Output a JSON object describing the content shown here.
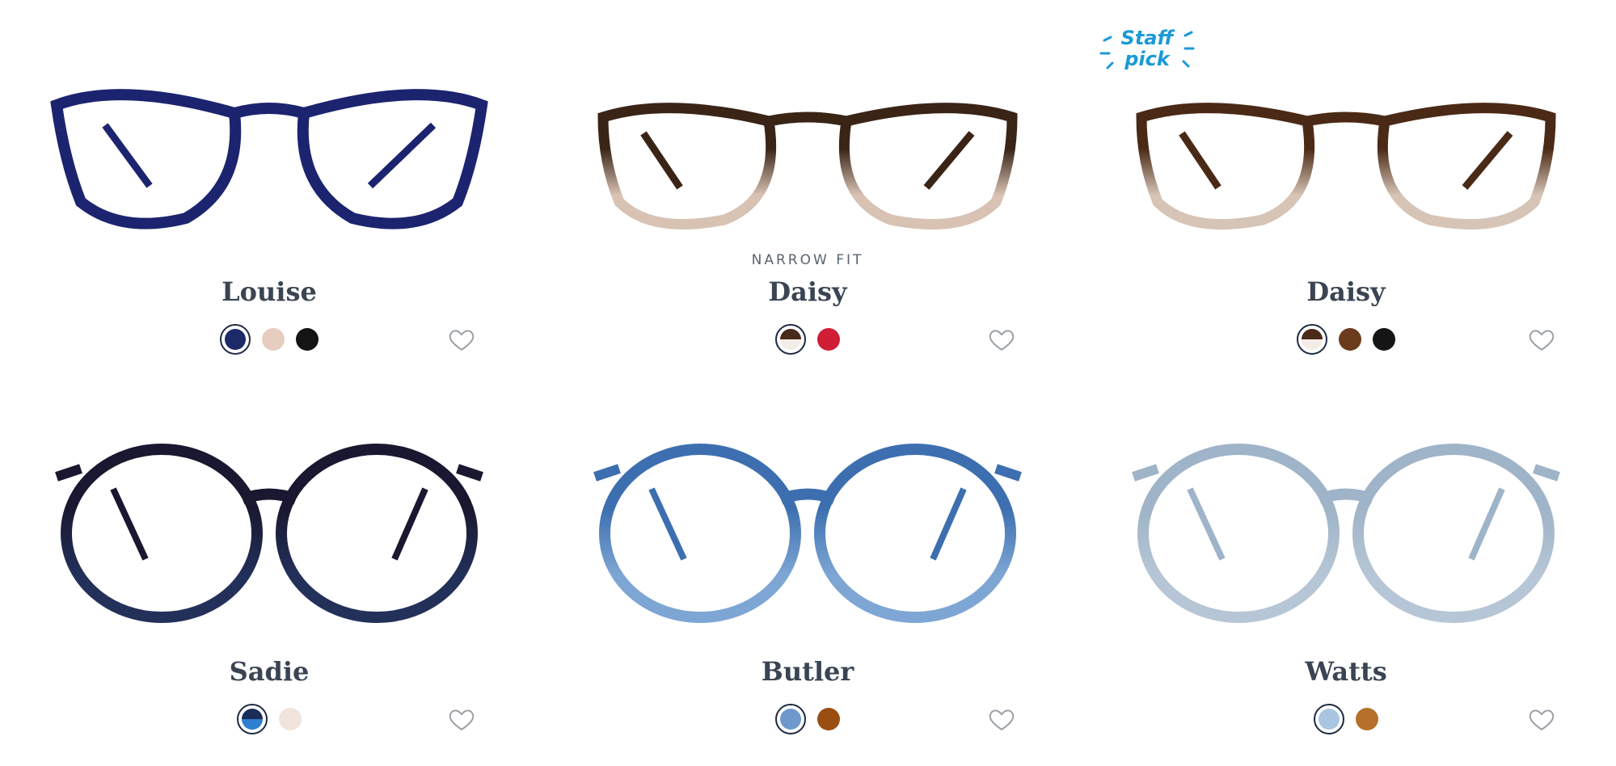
{
  "staff_pick_label": [
    "Staff",
    "pick"
  ],
  "products": [
    {
      "name": "Louise",
      "fit_label": "",
      "frame_style": "cat",
      "frame_color": "#1c2470",
      "frame_color_bottom": "#1c2470",
      "swatches": [
        {
          "color": "#1c2a6a",
          "selected": true
        },
        {
          "color": "#e7cdc0",
          "selected": false
        },
        {
          "color": "#141414",
          "selected": false
        }
      ]
    },
    {
      "name": "Daisy",
      "fit_label": "NARROW FIT",
      "frame_style": "soft",
      "frame_color": "#3a2416",
      "frame_color_bottom": "#d8c2b4",
      "swatches": [
        {
          "color": "#4a2a1a",
          "selected": true,
          "split": "#f4ece6"
        },
        {
          "color": "#d01e34",
          "selected": false
        }
      ]
    },
    {
      "name": "Daisy",
      "fit_label": "",
      "frame_style": "soft",
      "frame_color": "#4a2a16",
      "frame_color_bottom": "#d6c4b6",
      "swatches": [
        {
          "color": "#4a2a1a",
          "selected": true,
          "split": "#f4ece6"
        },
        {
          "color": "#6a3c1c",
          "selected": false
        },
        {
          "color": "#151515",
          "selected": false
        }
      ]
    },
    {
      "name": "Sadie",
      "fit_label": "",
      "frame_style": "round",
      "frame_color": "#1a1830",
      "frame_color_bottom": "#23305a",
      "swatches": [
        {
          "color": "#1a2c5a",
          "selected": true,
          "split": "#2f7fd0"
        },
        {
          "color": "#f0e4dc",
          "selected": false
        }
      ]
    },
    {
      "name": "Butler",
      "fit_label": "",
      "frame_style": "round",
      "frame_color": "#3d6fb0",
      "frame_color_bottom": "#7ea6d4",
      "swatches": [
        {
          "color": "#6f99cc",
          "selected": true
        },
        {
          "color": "#9a4e12",
          "selected": false
        }
      ]
    },
    {
      "name": "Watts",
      "fit_label": "",
      "frame_style": "round",
      "frame_color": "#9fb4c8",
      "frame_color_bottom": "#b6c6d6",
      "swatches": [
        {
          "color": "#a8c6e2",
          "selected": true
        },
        {
          "color": "#b5702a",
          "selected": false
        }
      ]
    }
  ]
}
